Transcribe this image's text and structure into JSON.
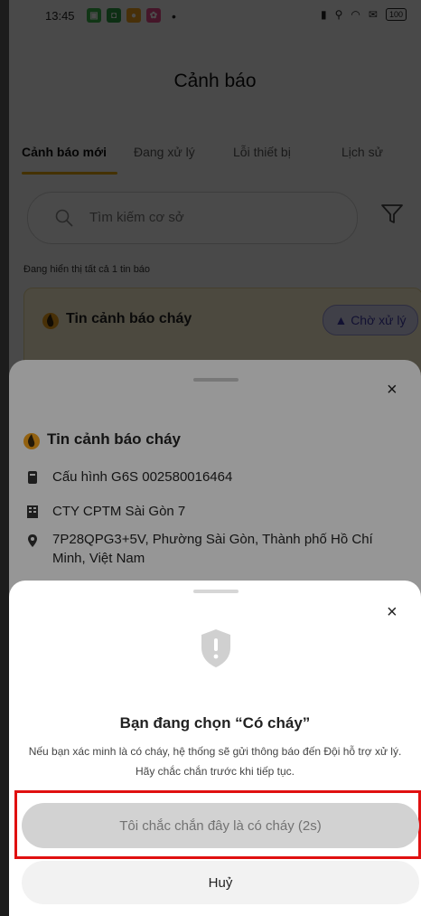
{
  "status_bar": {
    "time": "13:45",
    "dot": "•",
    "battery": "100"
  },
  "page_title": "Cảnh báo",
  "tabs": [
    {
      "label": "Cảnh báo mới",
      "active": true
    },
    {
      "label": "Đang xử lý",
      "active": false
    },
    {
      "label": "Lỗi thiết bị",
      "active": false
    },
    {
      "label": "Lịch sử",
      "active": false
    }
  ],
  "search": {
    "placeholder": "Tìm kiếm cơ sở"
  },
  "summary": "Đang hiển thị tất cả 1 tin báo",
  "alert_card": {
    "title": "Tin cảnh báo cháy",
    "status": "▲ Chờ xử lý"
  },
  "detail_sheet": {
    "title": "Tin cảnh báo cháy",
    "device": "Cấu hình G6S 002580016464",
    "company": "CTY CPTM Sài Gòn 7",
    "address": "7P28QPG3+5V, Phường Sài Gòn, Thành phố Hồ Chí Minh, Việt Nam",
    "close": "×"
  },
  "confirm_sheet": {
    "title": "Bạn đang chọn “Có cháy”",
    "description": "Nếu bạn xác minh là có cháy, hệ thống sẽ gửi thông báo đến Đội hỗ trợ xử lý. Hãy chắc chắn trước khi tiếp tục.",
    "confirm_label": "Tôi chắc chắn đây là có cháy (2s)",
    "cancel_label": "Huỷ",
    "close": "×"
  },
  "colors": {
    "accent": "#e4a400",
    "badge_bg": "#d9d8f3",
    "badge_text": "#3f3aa8",
    "highlight": "#e01010"
  }
}
